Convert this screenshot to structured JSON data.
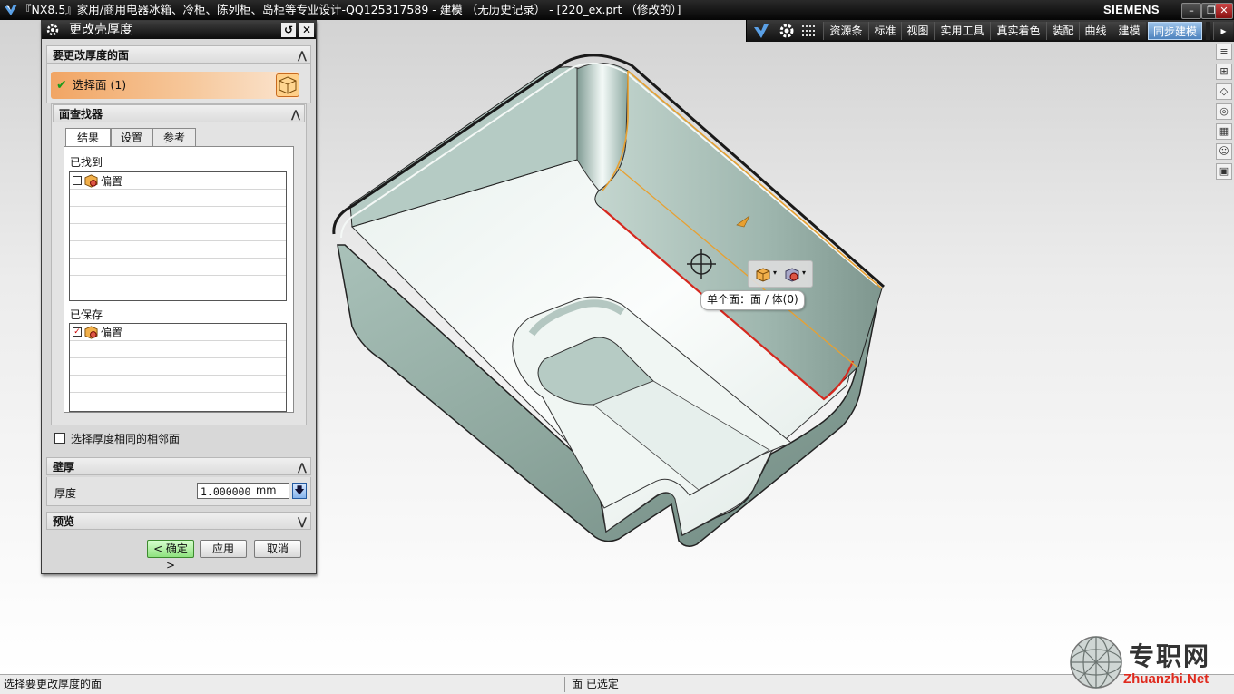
{
  "window": {
    "title": "『NX8.5』家用/商用电器冰箱、冷柜、陈列柜、岛柜等专业设计-QQ125317589 - 建模 （无历史记录） - [220_ex.prt （修改的）]",
    "brand": "SIEMENS",
    "minimize": "–",
    "restore": "❐",
    "close": "✕"
  },
  "ribbon": {
    "tabs": [
      {
        "label": "资源条"
      },
      {
        "label": "标准"
      },
      {
        "label": "视图"
      },
      {
        "label": "实用工具"
      },
      {
        "label": "真实着色"
      },
      {
        "label": "装配"
      },
      {
        "label": "曲线"
      },
      {
        "label": "建模"
      },
      {
        "label": "同步建模"
      }
    ],
    "active_tab": "同步建模"
  },
  "dialog": {
    "title": "更改壳厚度",
    "faces_group": {
      "header": "要更改厚度的面",
      "select_face": "选择面 (1)"
    },
    "finder_group": {
      "header": "面查找器",
      "tabs": [
        "结果",
        "设置",
        "参考"
      ],
      "found_label": "已找到",
      "found_items": [
        {
          "name": "偏置",
          "checked": false
        }
      ],
      "saved_label": "已保存",
      "saved_items": [
        {
          "name": "偏置",
          "checked": true
        }
      ]
    },
    "adjacent_checkbox": "选择厚度相同的相邻面",
    "thickness_group": {
      "header": "壁厚",
      "label": "厚度",
      "value": "1.000000",
      "unit": "mm"
    },
    "preview_group": {
      "header": "预览"
    },
    "buttons": {
      "ok": "< 确定 >",
      "apply": "应用",
      "cancel": "取消"
    }
  },
  "viewport": {
    "tooltip": "单个面：面 / 体(0)"
  },
  "statusbar": {
    "prompt": "选择要更改厚度的面",
    "status": "面 已选定"
  },
  "watermark": {
    "cn": "专职网",
    "url": "Zhuanzhi.Net"
  },
  "colors": {
    "highlight_edge": "#d6281e",
    "selected_face_edge": "#e8a030",
    "ribbon_active": "#5d8fc8",
    "select_step_bg": "#f1a564"
  }
}
